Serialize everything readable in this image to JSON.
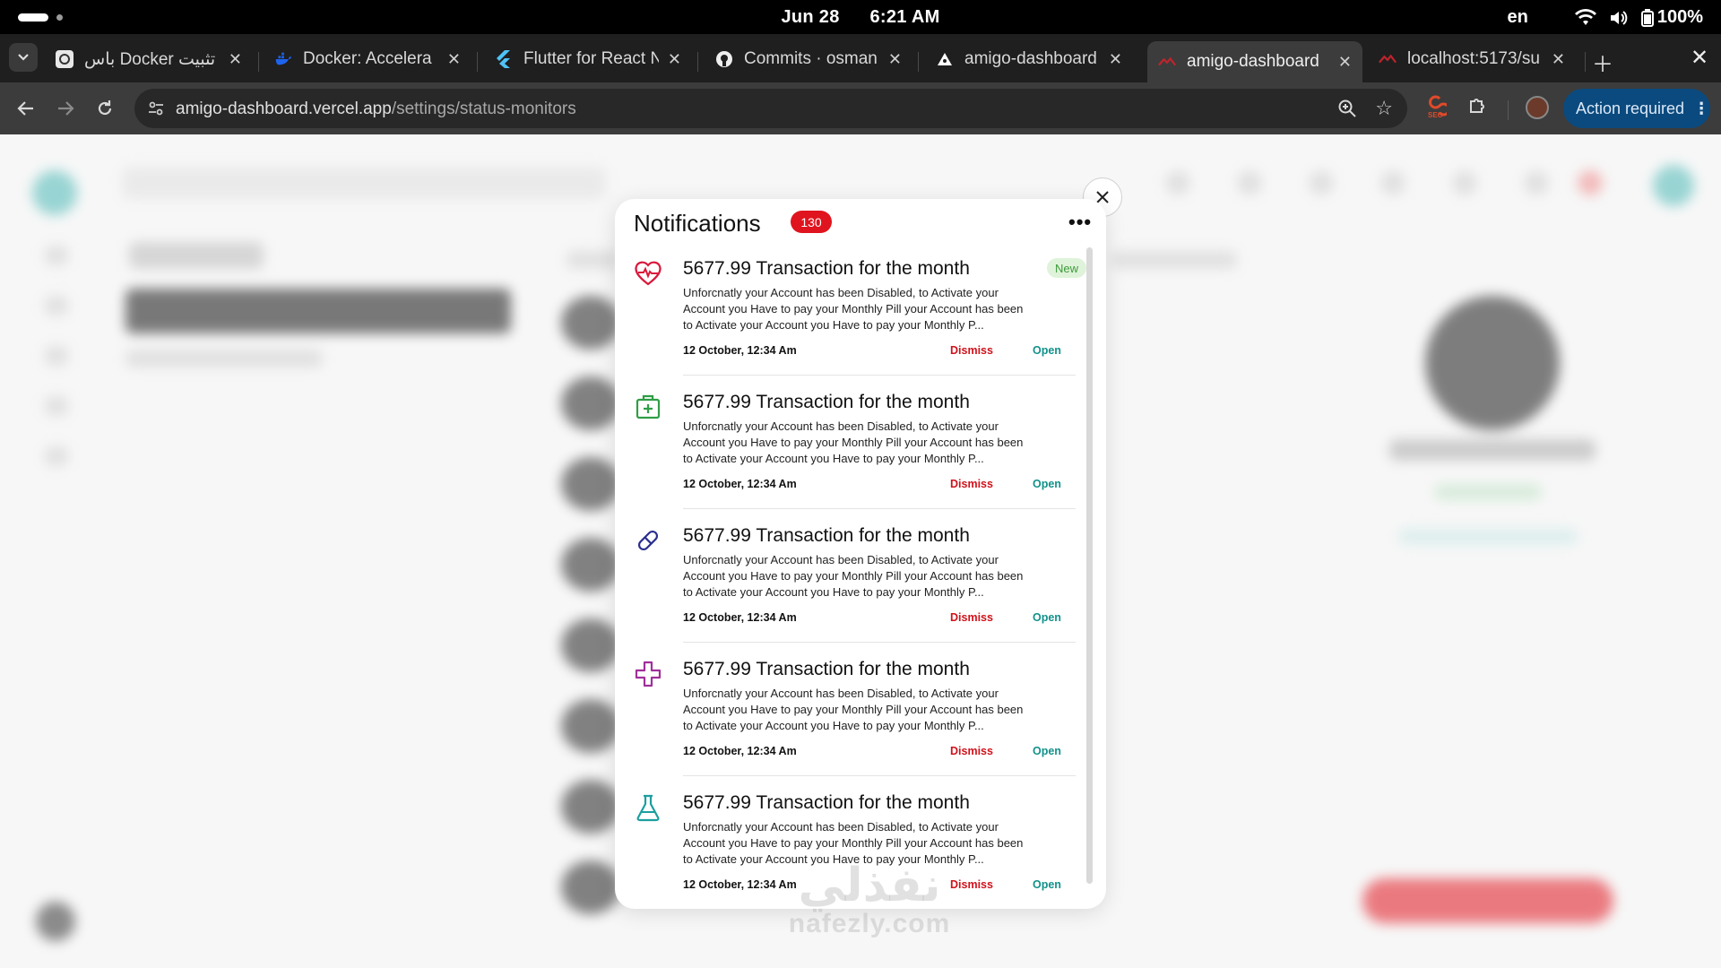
{
  "status_bar": {
    "date": "Jun 28",
    "time": "6:21 AM",
    "language": "en",
    "battery": "100%"
  },
  "tabs": [
    {
      "title": "تثبيت Docker باس",
      "icon": "openai-icon",
      "active": false
    },
    {
      "title": "Docker: Accelera",
      "icon": "docker-icon",
      "active": false
    },
    {
      "title": "Flutter for React N",
      "icon": "flutter-icon",
      "active": false
    },
    {
      "title": "Commits · osman",
      "icon": "github-icon",
      "active": false
    },
    {
      "title": "amigo-dashboard",
      "icon": "vercel-icon",
      "active": false
    },
    {
      "title": "amigo-dashboard",
      "icon": "app-icon",
      "active": true
    },
    {
      "title": "localhost:5173/su",
      "icon": "app-icon",
      "active": false
    }
  ],
  "toolbar": {
    "url_host": "amigo-dashboard.vercel.app",
    "url_path": "/settings/status-monitors",
    "action_label": "Action required"
  },
  "notifications": {
    "title": "Notifications",
    "count": "130",
    "new_badge": "New",
    "items": [
      {
        "icon": "heart-pulse-icon",
        "icon_color": "#d9183b",
        "title": "5677.99 Transaction for the month",
        "body": "Unforcnatly your Account has been Disabled, to Activate your Account you Have to pay your Monthly Pill your Account has been to Activate your Account you Have to pay your Monthly P...",
        "date": "12 October, 12:34 Am",
        "dismiss": "Dismiss",
        "open": "Open",
        "is_new": true
      },
      {
        "icon": "medical-kit-icon",
        "icon_color": "#2f9e46",
        "title": "5677.99 Transaction for the month",
        "body": "Unforcnatly your Account has been Disabled, to Activate your Account you Have to pay your Monthly Pill your Account has been to Activate your Account you Have to pay your Monthly P...",
        "date": "12 October, 12:34 Am",
        "dismiss": "Dismiss",
        "open": "Open",
        "is_new": false
      },
      {
        "icon": "pill-icon",
        "icon_color": "#2b2f8f",
        "title": "5677.99 Transaction for the month",
        "body": "Unforcnatly your Account has been Disabled, to Activate your Account you Have to pay your Monthly Pill your Account has been to Activate your Account you Have to pay your Monthly P...",
        "date": "12 October, 12:34 Am",
        "dismiss": "Dismiss",
        "open": "Open",
        "is_new": false
      },
      {
        "icon": "medical-cross-icon",
        "icon_color": "#a0309a",
        "title": "5677.99 Transaction for the month",
        "body": "Unforcnatly your Account has been Disabled, to Activate your Account you Have to pay your Monthly Pill your Account has been to Activate your Account you Have to pay your Monthly P...",
        "date": "12 October, 12:34 Am",
        "dismiss": "Dismiss",
        "open": "Open",
        "is_new": false
      },
      {
        "icon": "flask-icon",
        "icon_color": "#1c9fa0",
        "title": "5677.99 Transaction for the month",
        "body": "Unforcnatly your Account has been Disabled, to Activate your Account you Have to pay your Monthly Pill your Account has been to Activate your Account you Have to pay your Monthly P...",
        "date": "12 October, 12:34 Am",
        "dismiss": "Dismiss",
        "open": "Open",
        "is_new": false
      }
    ]
  },
  "watermark": {
    "arabic": "نفذلي",
    "latin": "nafezly.com"
  },
  "colors": {
    "badge_red": "#e0141e",
    "dismiss_red": "#d0121b",
    "open_teal": "#13918a",
    "action_blue": "#0b4a7e"
  }
}
